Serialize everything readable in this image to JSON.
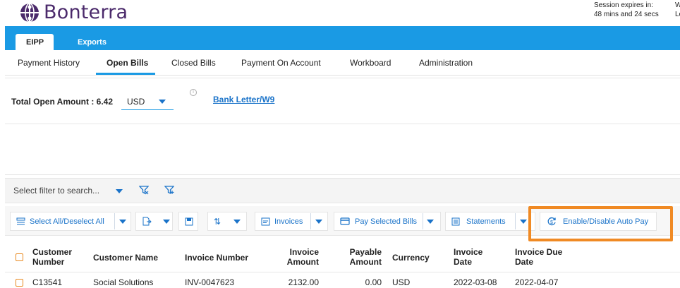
{
  "brand": {
    "name": "Bonterra",
    "logo_icon": "globe-people-icon",
    "color": "#4b2a6b"
  },
  "session": {
    "label": "Session expires in:",
    "time": "48 mins and 24 secs",
    "right_line1": "W",
    "right_line2": "Lo"
  },
  "top_tabs": [
    {
      "label": "EIPP",
      "active": true
    },
    {
      "label": "Exports",
      "active": false
    }
  ],
  "sub_tabs": [
    {
      "label": "Payment History"
    },
    {
      "label": "Open Bills",
      "active": true
    },
    {
      "label": "Closed Bills"
    },
    {
      "label": "Payment On Account"
    },
    {
      "label": "Workboard"
    },
    {
      "label": "Administration"
    }
  ],
  "total": {
    "label": "Total Open Amount : 6.42",
    "currency": "USD",
    "bank_link": "Bank Letter/W9"
  },
  "filter": {
    "placeholder": "Select filter to search..."
  },
  "toolbar": {
    "select_all": "Select All/Deselect All",
    "invoices": "Invoices",
    "pay_selected": "Pay Selected Bills",
    "statements": "Statements",
    "auto_pay": "Enable/Disable Auto Pay"
  },
  "table": {
    "headers": {
      "customer_number_1": "Customer",
      "customer_number_2": "Number",
      "customer_name": "Customer Name",
      "invoice_number": "Invoice Number",
      "invoice_amount_1": "Invoice",
      "invoice_amount_2": "Amount",
      "payable_amount_1": "Payable",
      "payable_amount_2": "Amount",
      "currency": "Currency",
      "invoice_date_1": "Invoice",
      "invoice_date_2": "Date",
      "due_date_1": "Invoice Due",
      "due_date_2": "Date"
    },
    "rows": [
      {
        "customer_number": "C13541",
        "customer_name": "Social Solutions",
        "invoice_number": "INV-0047623",
        "invoice_amount": "2132.00",
        "payable_amount": "0.00",
        "currency": "USD",
        "invoice_date": "2022-03-08",
        "due_date": "2022-04-07"
      }
    ]
  },
  "colors": {
    "accent": "#1a9ae4",
    "link": "#1a73c9",
    "highlight": "#f08a24",
    "checkbox": "#e8891f"
  }
}
